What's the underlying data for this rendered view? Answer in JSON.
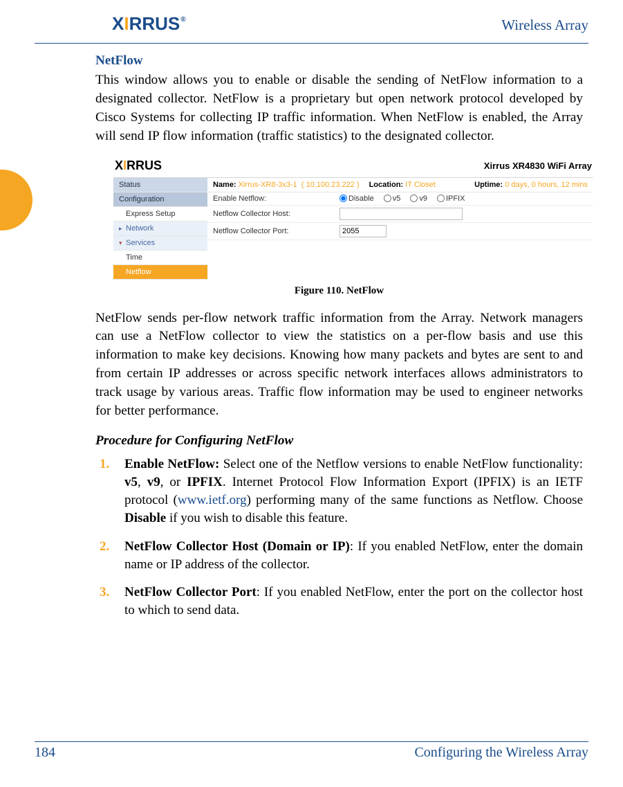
{
  "header": {
    "brand_pre": "X",
    "brand_dot": "I",
    "brand_post": "RRUS",
    "brand_reg": "®",
    "right": "Wireless Array"
  },
  "section_title": "NetFlow",
  "para1": "This window allows you to enable or disable the sending of NetFlow information to a designated collector. NetFlow is a proprietary but open network protocol developed by Cisco Systems for collecting IP traffic information. When NetFlow is enabled, the Array will send IP flow information (traffic statistics) to the designated collector.",
  "figure": {
    "brand_pre": "X",
    "brand_dot": "I",
    "brand_post": "RRUS",
    "model": "Xirrus XR4830 WiFi Array",
    "nav": {
      "status": "Status",
      "config": "Configuration",
      "express": "Express Setup",
      "network": "Network",
      "services": "Services",
      "time": "Time",
      "netflow": "Netflow"
    },
    "info": {
      "name_lbl": "Name:",
      "name_val": "Xirrus-XR8-3x3-1",
      "ip": "( 10.100.23.222 )",
      "loc_lbl": "Location:",
      "loc_val": "IT Closet",
      "up_lbl": "Uptime:",
      "up_val": "0 days, 0 hours, 12 mins"
    },
    "form": {
      "enable_lbl": "Enable Netflow:",
      "opt_disable": "Disable",
      "opt_v5": "v5",
      "opt_v9": "v9",
      "opt_ipfix": "IPFIX",
      "host_lbl": "Netflow Collector Host:",
      "host_val": "",
      "port_lbl": "Netflow Collector Port:",
      "port_val": "2055"
    }
  },
  "fig_caption": "Figure 110. NetFlow",
  "para2": "NetFlow sends per-flow network traffic information from the Array. Network managers can use a NetFlow collector to view the statistics on a per-flow basis and use this information to make key decisions. Knowing how many packets and bytes are sent to and from certain IP addresses or across specific network interfaces allows administrators to track usage by various areas. Traffic flow information may be used to engineer networks for better performance.",
  "proc_head": "Procedure for Configuring NetFlow",
  "steps": {
    "s1a": "Enable NetFlow: ",
    "s1b": "Select one of the Netflow versions to enable NetFlow functionality: ",
    "s1_v5": "v5",
    "s1_c1": ", ",
    "s1_v9": "v9",
    "s1_c2": ", or ",
    "s1_ipfix": "IPFIX",
    "s1_post": ". Internet Protocol Flow Information Export (IPFIX) is an IETF protocol (",
    "s1_link": "www.ietf.org",
    "s1_post2": ") performing many of the same functions as Netflow. Choose ",
    "s1_dis": "Disable",
    "s1_post3": " if you wish to disable this feature.",
    "s2a": "NetFlow Collector Host (Domain or IP)",
    "s2b": ": If you enabled NetFlow, enter the domain name or IP address of the collector.",
    "s3a": "NetFlow Collector Port",
    "s3b": ": If you enabled NetFlow, enter the port on the collector host to which to send data."
  },
  "footer": {
    "page": "184",
    "title": "Configuring the Wireless Array"
  }
}
